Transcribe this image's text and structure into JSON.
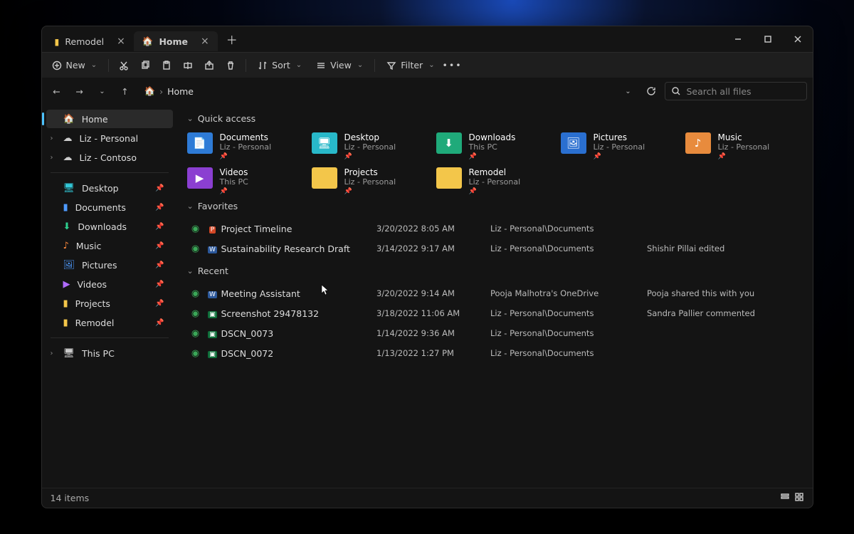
{
  "tabs": [
    {
      "label": "Remodel",
      "icon": "folder-icon",
      "active": false
    },
    {
      "label": "Home",
      "icon": "home-icon",
      "active": true
    }
  ],
  "toolbar": {
    "new_label": "New",
    "sort_label": "Sort",
    "view_label": "View",
    "filter_label": "Filter"
  },
  "breadcrumb": {
    "root_icon": "home-icon",
    "segments": [
      "Home"
    ]
  },
  "search": {
    "placeholder": "Search all files"
  },
  "sidebar": {
    "top": [
      {
        "label": "Home",
        "icon": "home-icon",
        "selected": true
      },
      {
        "label": "Liz - Personal",
        "icon": "cloud-icon",
        "expandable": true
      },
      {
        "label": "Liz - Contoso",
        "icon": "cloud-icon",
        "expandable": true
      }
    ],
    "pinned": [
      {
        "label": "Desktop",
        "icon": "desktop-icon",
        "color": "f-cyan"
      },
      {
        "label": "Documents",
        "icon": "document-icon",
        "color": "f-blue"
      },
      {
        "label": "Downloads",
        "icon": "download-icon",
        "color": "f-green"
      },
      {
        "label": "Music",
        "icon": "music-icon",
        "color": "f-orange"
      },
      {
        "label": "Pictures",
        "icon": "picture-icon",
        "color": "f-pic"
      },
      {
        "label": "Videos",
        "icon": "video-icon",
        "color": "f-purple"
      },
      {
        "label": "Projects",
        "icon": "folder-icon",
        "color": "f-yellow"
      },
      {
        "label": "Remodel",
        "icon": "folder-icon",
        "color": "f-yellow"
      }
    ],
    "bottom": [
      {
        "label": "This PC",
        "icon": "pc-icon",
        "expandable": true
      }
    ]
  },
  "sections": {
    "quick_access": {
      "title": "Quick access"
    },
    "favorites": {
      "title": "Favorites"
    },
    "recent": {
      "title": "Recent"
    }
  },
  "quick_access": [
    {
      "name": "Documents",
      "sub": "Liz - Personal",
      "color": "f-blue",
      "glyph": "📄"
    },
    {
      "name": "Desktop",
      "sub": "Liz - Personal",
      "color": "f-cyan",
      "glyph": "🖥"
    },
    {
      "name": "Downloads",
      "sub": "This PC",
      "color": "f-green",
      "glyph": "⬇"
    },
    {
      "name": "Pictures",
      "sub": "Liz - Personal",
      "color": "f-pic",
      "glyph": "🖼"
    },
    {
      "name": "Music",
      "sub": "Liz - Personal",
      "color": "f-orange",
      "glyph": "♪"
    },
    {
      "name": "Videos",
      "sub": "This PC",
      "color": "f-purple",
      "glyph": "▶"
    },
    {
      "name": "Projects",
      "sub": "Liz - Personal",
      "color": "f-yellow",
      "glyph": ""
    },
    {
      "name": "Remodel",
      "sub": "Liz - Personal",
      "color": "f-yellow",
      "glyph": ""
    }
  ],
  "favorites": [
    {
      "name": "Project Timeline",
      "date": "3/20/2022 8:05 AM",
      "location": "Liz - Personal\\Documents",
      "activity": "",
      "type_icon": "ppt-icon"
    },
    {
      "name": "Sustainability Research Draft",
      "date": "3/14/2022 9:17 AM",
      "location": "Liz - Personal\\Documents",
      "activity": "Shishir Pillai edited",
      "type_icon": "word-icon"
    }
  ],
  "recent": [
    {
      "name": "Meeting Assistant",
      "date": "3/20/2022 9:14 AM",
      "location": "Pooja Malhotra's OneDrive",
      "activity": "Pooja shared this with you",
      "type_icon": "word-icon"
    },
    {
      "name": "Screenshot 29478132",
      "date": "3/18/2022 11:06 AM",
      "location": "Liz - Personal\\Documents",
      "activity": "Sandra Pallier commented",
      "type_icon": "image-icon"
    },
    {
      "name": "DSCN_0073",
      "date": "1/14/2022 9:36 AM",
      "location": "Liz - Personal\\Documents",
      "activity": "",
      "type_icon": "image-icon"
    },
    {
      "name": "DSCN_0072",
      "date": "1/13/2022 1:27 PM",
      "location": "Liz - Personal\\Documents",
      "activity": "",
      "type_icon": "image-icon"
    }
  ],
  "status": {
    "count_label": "14 items"
  }
}
